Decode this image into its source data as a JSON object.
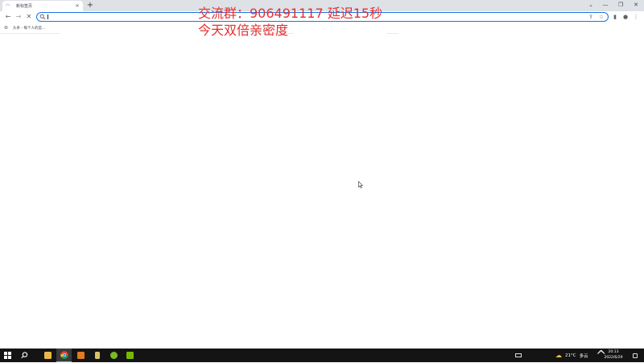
{
  "browser": {
    "tab": {
      "title": "新标签页",
      "favicon": "loading-spinner-icon",
      "close": "✕"
    },
    "new_tab_label": "+",
    "window_controls": {
      "tab_search": "⌄",
      "minimize": "—",
      "restore": "❐",
      "close": "✕"
    },
    "nav": {
      "back": "←",
      "forward": "→",
      "reload": "✕"
    },
    "omnibox": {
      "value": "",
      "placeholder": ""
    },
    "omnibox_icons": {
      "share": "⇪",
      "bookmark": "☆"
    },
    "toolbar_icons": {
      "side_panel": "▮",
      "profile": "●",
      "menu": "⋮"
    },
    "bookmarks": [
      {
        "label": "头条 - 每个人的首...",
        "icon": "toutiao-icon"
      }
    ]
  },
  "overlay": {
    "line1": "交流群：906491117 延迟15秒",
    "line2": "今天双倍亲密度",
    "color": "#e52e2e"
  },
  "taskbar": {
    "start_icon": "windows-start-icon",
    "search_icon": "search-icon",
    "apps": [
      {
        "name": "file-explorer",
        "color": "#e8b84a",
        "active": false
      },
      {
        "name": "chrome",
        "color": "#4f89d8",
        "active": true
      },
      {
        "name": "app-orange",
        "color": "#e07a1f",
        "active": false
      },
      {
        "name": "app-yellow",
        "color": "#d8c36a",
        "active": false
      },
      {
        "name": "app-green-circle",
        "color": "#7ab929",
        "active": false
      },
      {
        "name": "nvidia",
        "color": "#76b900",
        "active": false
      }
    ],
    "tray": {
      "weather_temp": "21°C",
      "weather_desc": "多云",
      "chevron": "^",
      "time": "20:13",
      "date": "2022/6/29"
    }
  }
}
